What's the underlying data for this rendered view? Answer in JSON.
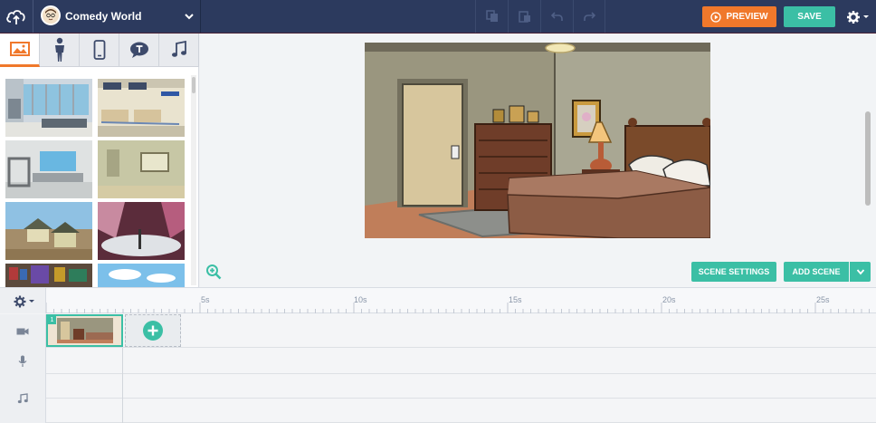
{
  "topbar": {
    "project_title": "Comedy World",
    "preview_label": "PREVIEW",
    "save_label": "SAVE",
    "icons": [
      "upload-cloud-icon",
      "chevron-down-icon",
      "copy-icon",
      "paste-icon",
      "undo-icon",
      "redo-icon",
      "gear-icon"
    ]
  },
  "left_panel": {
    "tabs": [
      {
        "name": "backgrounds",
        "icon": "image-icon",
        "active": true
      },
      {
        "name": "characters",
        "icon": "person-icon",
        "active": false
      },
      {
        "name": "props",
        "icon": "phone-icon",
        "active": false
      },
      {
        "name": "text",
        "icon": "speech-bubble-icon",
        "active": false
      },
      {
        "name": "audio",
        "icon": "music-note-icon",
        "active": false
      }
    ],
    "backgrounds": [
      "airport-lounge",
      "airport-checkin",
      "security-checkpoint",
      "tent-room",
      "suburban-houses",
      "stage-spotlights",
      "bookshelf-room",
      "sky-clouds"
    ]
  },
  "stage": {
    "scene_settings_label": "SCENE SETTINGS",
    "add_scene_label": "ADD SCENE"
  },
  "timeline": {
    "ticks": [
      {
        "label": "5s"
      },
      {
        "label": "10s"
      },
      {
        "label": "15s"
      },
      {
        "label": "20s"
      },
      {
        "label": "25s"
      }
    ],
    "scene_number": "1",
    "tracks": [
      "video-camera-icon",
      "microphone-icon",
      "music-note-icon"
    ]
  },
  "colors": {
    "topbar": "#2c3a5e",
    "accent_orange": "#f0782b",
    "accent_teal": "#3bbfa5"
  }
}
